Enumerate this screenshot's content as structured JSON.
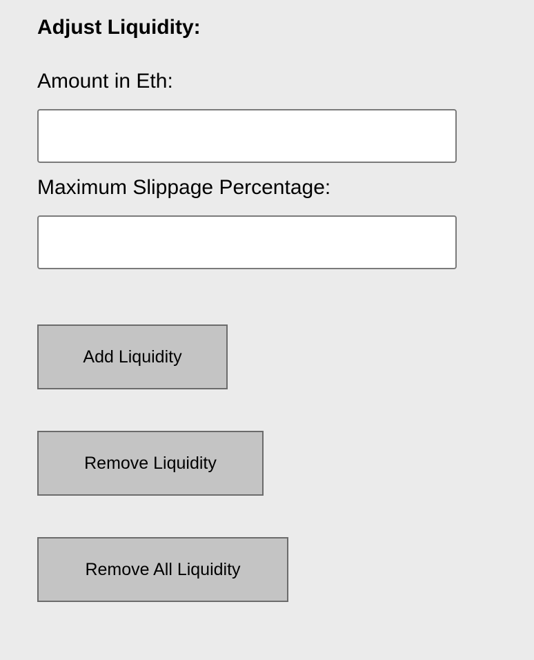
{
  "section": {
    "title": "Adjust Liquidity:"
  },
  "form": {
    "amount_label": "Amount in Eth:",
    "amount_value": "",
    "amount_placeholder": "",
    "slippage_label": "Maximum Slippage Percentage:",
    "slippage_value": "",
    "slippage_placeholder": ""
  },
  "actions": {
    "add_label": "Add Liquidity",
    "remove_label": "Remove Liquidity",
    "remove_all_label": "Remove All Liquidity"
  },
  "colors": {
    "background": "#ebebeb",
    "input_background": "#ffffff",
    "button_background": "#c4c4c4",
    "border": "#6b6b6b"
  }
}
